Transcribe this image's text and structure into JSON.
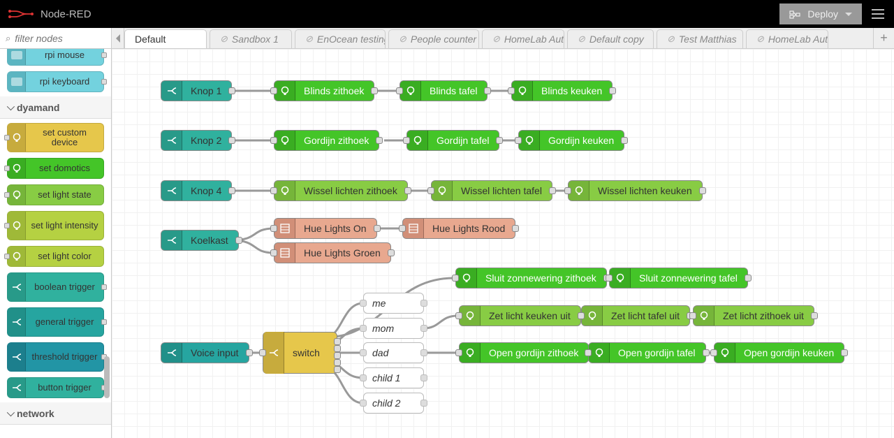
{
  "header": {
    "title": "Node-RED",
    "deploy_label": "Deploy"
  },
  "sidebar": {
    "filter_placeholder": "filter nodes",
    "rpi_nodes": [
      "rpi mouse",
      "rpi keyboard"
    ],
    "cat_dyamand": "dyamand",
    "dyamand_nodes": [
      "set custom device",
      "set domotics",
      "set light state",
      "set light intensity",
      "set light color",
      "boolean trigger",
      "general trigger",
      "threshold trigger",
      "button trigger"
    ],
    "cat_network": "network"
  },
  "tabs": [
    {
      "label": "Default",
      "active": true,
      "disabled": false
    },
    {
      "label": "Sandbox 1",
      "active": false,
      "disabled": true
    },
    {
      "label": "EnOcean testing",
      "active": false,
      "disabled": true
    },
    {
      "label": "People counter",
      "active": false,
      "disabled": true
    },
    {
      "label": "HomeLab Automa",
      "active": false,
      "disabled": true
    },
    {
      "label": "Default copy",
      "active": false,
      "disabled": true
    },
    {
      "label": "Test Matthias",
      "active": false,
      "disabled": true
    },
    {
      "label": "HomeLab Automa",
      "active": false,
      "disabled": true
    }
  ],
  "flow": {
    "knop1": "Knop 1",
    "blinds_zithoek": "Blinds zithoek",
    "blinds_tafel": "Blinds tafel",
    "blinds_keuken": "Blinds keuken",
    "knop2": "Knop 2",
    "gordijn_zithoek": "Gordijn zithoek",
    "gordijn_tafel": "Gordijn tafel",
    "gordijn_keuken": "Gordijn keuken",
    "knop4": "Knop 4",
    "wissel_zithoek": "Wissel lichten zithoek",
    "wissel_tafel": "Wissel lichten tafel",
    "wissel_keuken": "Wissel lichten keuken",
    "koelkast": "Koelkast",
    "hue_on": "Hue Lights On",
    "hue_rood": "Hue Lights Rood",
    "hue_groen": "Hue Lights Groen",
    "voice_input": "Voice input",
    "switch": "switch",
    "sub_me": "me",
    "sub_mom": "mom",
    "sub_dad": "dad",
    "sub_child1": "child 1",
    "sub_child2": "child 2",
    "sluit_zithoek": "Sluit zonnewering zithoek",
    "sluit_tafel": "Sluit zonnewering tafel",
    "zet_keuken_uit": "Zet licht keuken uit",
    "zet_tafel_uit": "Zet licht tafel uit",
    "zet_zithoek_uit": "Zet licht zithoek uit",
    "open_zithoek": "Open gordijn zithoek",
    "open_tafel": "Open gordijn tafel",
    "open_keuken": "Open gordijn keuken"
  }
}
